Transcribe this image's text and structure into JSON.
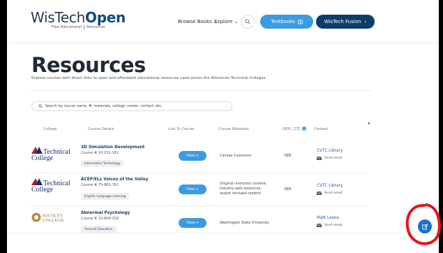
{
  "header": {
    "logo_brand": "WisTech",
    "logo_bold": "Open",
    "logo_tag_left": "Free Educational",
    "logo_tag_right": "Resources",
    "browse_books": "Browse Books",
    "explore": "Explore",
    "textbooks_label": "Textbooks",
    "fusion_label": "WisTech Fusion"
  },
  "page": {
    "title": "Resources",
    "subtitle": "Explore courses with direct links to open and affordable educational resources used across the Wisconsin Technical Colleges."
  },
  "search": {
    "placeholder": "Search by course name, #, materials, college, career, contact, etc."
  },
  "table": {
    "headers": {
      "college": "College",
      "details": "Course Details",
      "link": "Link To Course",
      "materials": "Course Materials",
      "oer": "OER / ZTC",
      "contact": "Contact"
    },
    "rows": [
      {
        "college_logo": "Chippewa Valley Technical College",
        "logo_line1": "Technical",
        "logo_line2": "College",
        "course_title": "3D Simulation Development",
        "course_num": "Course # 10-152-181",
        "tag": "Information Technology",
        "view": "View >",
        "materials": [
          "Canvas Commons"
        ],
        "oer": "OER",
        "contact": "CVTC Library",
        "email": "Send email"
      },
      {
        "college_logo": "Chippewa Valley Technical College",
        "logo_line1": "Technical",
        "logo_line2": "College",
        "course_title": "ACEP/ELL Voices of the Valley",
        "course_num": "Course # 75-865-761",
        "tag": "English Language Learning",
        "view": "View >",
        "materials": [
          "Original instructor content,",
          "Industry web resources,",
          "and/or remixed content"
        ],
        "oer": "OER",
        "contact": "CVTC Library",
        "email": "Send email"
      },
      {
        "college_logo": "Nicolet College",
        "logo_line1": "NICOLET",
        "logo_line2": "COLLEGE",
        "course_title": "Abnormal Psychology",
        "course_num": "Course # 10-809-159",
        "tag": "General Education",
        "view": "View >",
        "materials": [
          "Washington State University"
        ],
        "oer": "",
        "contact": "Matt Laska",
        "email": "Send email"
      }
    ]
  },
  "colors": {
    "accent": "#3b9be0",
    "navy": "#0d3d6d",
    "link": "#1d5fa8",
    "annotation": "#e8141c"
  }
}
